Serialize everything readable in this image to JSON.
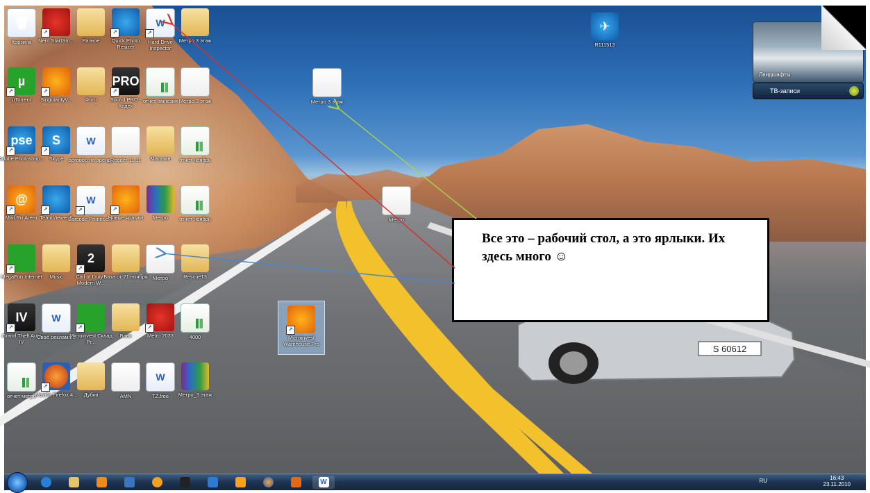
{
  "desktop": {
    "icons": [
      {
        "label": "Корзина",
        "kind": "recycle",
        "shortcut": false
      },
      {
        "label": "Nero StartSm...",
        "kind": "red",
        "shortcut": true
      },
      {
        "label": "Разное",
        "kind": "folder",
        "shortcut": false
      },
      {
        "label": "Quick Photo Resizer",
        "kind": "blue",
        "shortcut": true
      },
      {
        "label": "Hard Drive Inspector",
        "kind": "doc",
        "shortcut": true
      },
      {
        "label": "Метро 3 этаж",
        "kind": "folder",
        "shortcut": false
      },
      {
        "label": "µTorrent",
        "kind": "green",
        "shortcut": true,
        "glyph": "µ"
      },
      {
        "label": "SingularityV...",
        "kind": "orange",
        "shortcut": true
      },
      {
        "label": "Фото",
        "kind": "folder",
        "shortcut": false
      },
      {
        "label": "Sound PRO - Кодек",
        "kind": "dark",
        "shortcut": true,
        "glyph": "PRO"
      },
      {
        "label": "отчет амнезия",
        "kind": "xls",
        "shortcut": false
      },
      {
        "label": "Метро 3 этаж",
        "kind": "pdf",
        "shortcut": false
      },
      {
        "label": "Adobe Photoshop...",
        "kind": "blue",
        "shortcut": true,
        "glyph": "pse"
      },
      {
        "label": "Skype",
        "kind": "blue",
        "shortcut": true,
        "glyph": "S"
      },
      {
        "label": "договор на аренду",
        "kind": "doc",
        "shortcut": false
      },
      {
        "label": "Reader 11.11",
        "kind": "pdf",
        "shortcut": false
      },
      {
        "label": "Магазин",
        "kind": "folder",
        "shortcut": false
      },
      {
        "label": "отчет ноябрь",
        "kind": "xls",
        "shortcut": false
      },
      {
        "label": "Mail.Ru Агент",
        "kind": "orange",
        "shortcut": true,
        "glyph": "@"
      },
      {
        "label": "TeamViewer 5",
        "kind": "blue",
        "shortcut": true
      },
      {
        "label": "Barcode Printer.exe",
        "kind": "doc",
        "shortcut": true
      },
      {
        "label": "Новые ярлыки",
        "kind": "orange",
        "shortcut": true
      },
      {
        "label": "Метро",
        "kind": "rar",
        "shortcut": false
      },
      {
        "label": "отчет ноябрь",
        "kind": "xls",
        "shortcut": false
      },
      {
        "label": "MegaFon Internet",
        "kind": "green",
        "shortcut": true
      },
      {
        "label": "Music",
        "kind": "folder",
        "shortcut": false
      },
      {
        "label": "Call of Duty - Modern W...",
        "kind": "dark",
        "shortcut": true,
        "glyph": "2"
      },
      {
        "label": "База от 21 ноября",
        "kind": "folder",
        "shortcut": false
      },
      {
        "label": "Метро",
        "kind": "pdf",
        "shortcut": false
      },
      {
        "label": "Rescue13",
        "kind": "folder",
        "shortcut": false
      },
      {
        "label": "Grand Theft Auto IV",
        "kind": "dark",
        "shortcut": true,
        "glyph": "IV"
      },
      {
        "label": "Своё рекламн...",
        "kind": "doc",
        "shortcut": false
      },
      {
        "label": "Microinvest Склад Pr...",
        "kind": "green",
        "shortcut": true
      },
      {
        "label": "Банк",
        "kind": "folder",
        "shortcut": false
      },
      {
        "label": "Metro 2033",
        "kind": "red",
        "shortcut": true
      },
      {
        "label": "4000",
        "kind": "xls",
        "shortcut": false
      },
      {
        "label": "отчет метро",
        "kind": "xls",
        "shortcut": false
      },
      {
        "label": "Mozilla Firefox 4...",
        "kind": "ff",
        "shortcut": true
      },
      {
        "label": "Дубки",
        "kind": "folder",
        "shortcut": false
      },
      {
        "label": "AMN",
        "kind": "pdf",
        "shortcut": false
      },
      {
        "label": "TZ.free",
        "kind": "doc",
        "shortcut": false
      },
      {
        "label": "Метро_3 этаж",
        "kind": "rar",
        "shortcut": false
      },
      {
        "label": "R111513",
        "kind": "blue",
        "shortcut": false
      },
      {
        "label": "Метро 3 этаж",
        "kind": "pdf",
        "shortcut": false
      },
      {
        "label": "Метро",
        "kind": "pdf",
        "shortcut": false
      },
      {
        "label": "Microinvest Warehouse Pro",
        "kind": "orange",
        "shortcut": true
      }
    ]
  },
  "gadget": {
    "slideshow_caption": "Ландшафты",
    "tv_label": "ТВ-записи"
  },
  "callout": {
    "text": "Все это – рабочий стол, а это ярлыки. Их здесь много ☺"
  },
  "taskbar": {
    "language": "RU",
    "time": "16:43",
    "date": "23.11.2010"
  },
  "colors": {
    "arrow_red": "#d6322a",
    "arrow_green": "#a8cf4a",
    "arrow_blue": "#4a86c8"
  }
}
